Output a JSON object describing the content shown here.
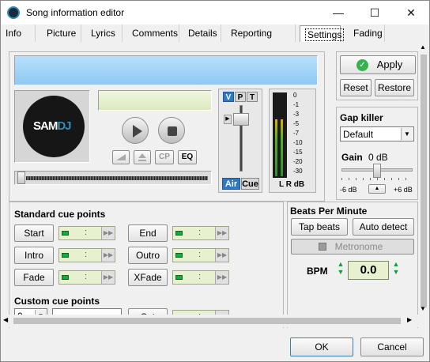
{
  "window": {
    "title": "Song information editor",
    "controls": {
      "minimize": "—",
      "maximize": "☐",
      "close": "✕"
    }
  },
  "tabs": [
    {
      "label": "Info"
    },
    {
      "label": "Picture"
    },
    {
      "label": "Lyrics"
    },
    {
      "label": "Comments"
    },
    {
      "label": "Details"
    },
    {
      "label": "Reporting fields"
    },
    {
      "label": "Settings"
    },
    {
      "label": "Fading"
    }
  ],
  "player": {
    "logo_text": "SAM",
    "logo_text_accent": "DJ",
    "mixer_tabs": [
      "V",
      "P",
      "T"
    ],
    "air_label": "Air",
    "cue_label": "Cue",
    "eq_label": "EQ",
    "cp_label": "CP",
    "vu_scale": [
      "0",
      "-1",
      "-3",
      "-5",
      "-7",
      "-10",
      "-15",
      "-20",
      "-30"
    ],
    "lr_label": "L R dB"
  },
  "actions": {
    "apply": "Apply",
    "reset": "Reset",
    "restore": "Restore"
  },
  "gap_killer": {
    "title": "Gap killer",
    "selected": "Default",
    "gain_label": "Gain",
    "gain_value": "0 dB",
    "min_label": "-6 dB",
    "max_label": "+6 dB"
  },
  "cue_points": {
    "title": "Standard cue points",
    "left": [
      "Start",
      "Intro",
      "Fade"
    ],
    "right": [
      "End",
      "Outro",
      "XFade"
    ],
    "field_colon": ":"
  },
  "custom_cue": {
    "title": "Custom cue points",
    "number": "0",
    "set_label": "Set"
  },
  "bpm": {
    "title": "Beats Per Minute",
    "tap": "Tap beats",
    "auto": "Auto detect",
    "metronome": "Metronome",
    "label": "BPM",
    "value": "0.0"
  },
  "footer": {
    "ok": "OK",
    "cancel": "Cancel"
  },
  "colors": {
    "accent": "#2f8fb7",
    "lcd": "#9fd0f5",
    "field": "#e7f0cf",
    "led": "#19a83e"
  }
}
